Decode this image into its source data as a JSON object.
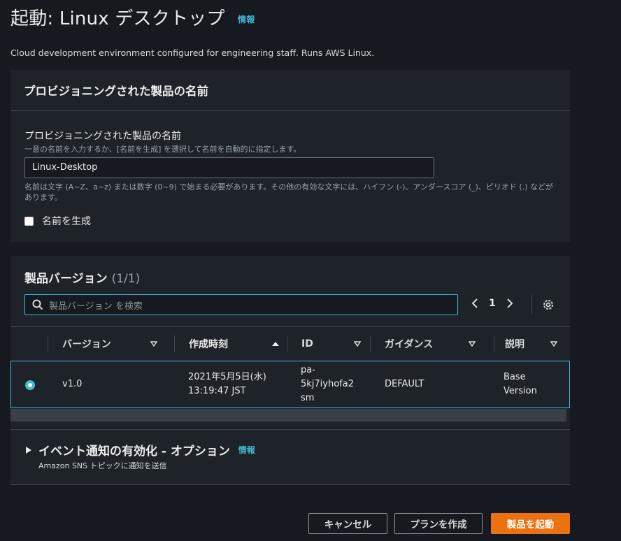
{
  "page": {
    "title": "起動: Linux デスクトップ",
    "info_label": "情報",
    "description": "Cloud development environment configured for engineering staff. Runs AWS Linux."
  },
  "name_panel": {
    "header": "プロビジョニングされた製品の名前",
    "field_label": "プロビジョニングされた製品の名前",
    "field_hint": "一意の名前を入力するか、[名前を生成] を選択して名前を自動的に指定します。",
    "field_value": "Linux-Desktop",
    "field_constraint": "名前は文字 (A~Z、a~z) または数字 (0~9) で始まる必要があります。その他の有効な文字には、ハイフン (-)、アンダースコア (_)、ピリオド (.) などがあります。",
    "generate_checkbox_label": "名前を生成",
    "generate_checked": false
  },
  "versions_panel": {
    "title": "製品バージョン",
    "count": "(1/1)",
    "search_placeholder": "製品バージョン を検索",
    "page_number": "1",
    "columns": [
      "バージョン",
      "作成時刻",
      "ID",
      "ガイダンス",
      "説明"
    ],
    "sorted_column": "作成時刻",
    "rows": [
      {
        "selected": true,
        "version": "v1.0",
        "created": [
          "2021年5月5日(水)",
          "13:19:47 JST"
        ],
        "id": [
          "pa-",
          "5kj7iyhofa2",
          "sm"
        ],
        "guidance": "DEFAULT",
        "description": [
          "Base",
          "Version"
        ]
      }
    ]
  },
  "events_panel": {
    "title": "イベント通知の有効化 - オプション",
    "info_label": "情報",
    "subtitle": "Amazon SNS トピックに通知を送信"
  },
  "footer": {
    "cancel_label": "キャンセル",
    "plan_label": "プランを作成",
    "launch_label": "製品を起動"
  },
  "colors": {
    "background": "#16191f",
    "panel": "#1e2229",
    "accent_blue": "#44b9d6",
    "primary_orange": "#ec7211"
  }
}
